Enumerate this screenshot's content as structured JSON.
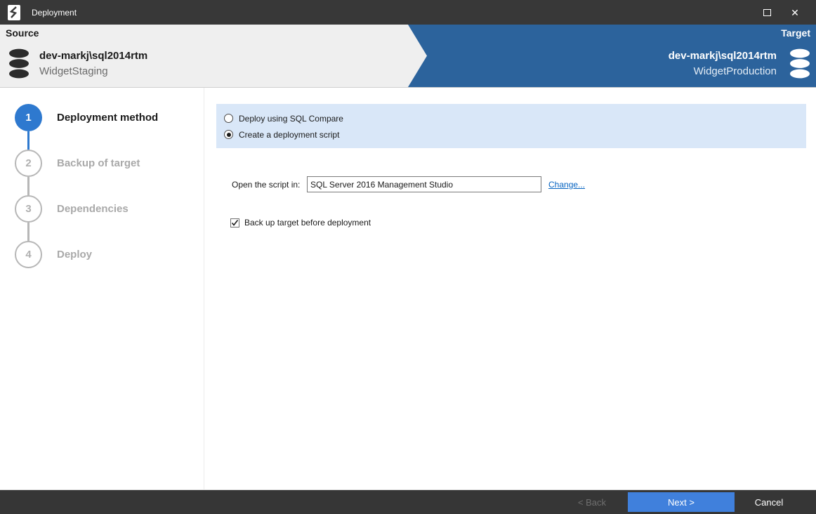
{
  "window": {
    "title": "Deployment"
  },
  "icons": {
    "close": "✕"
  },
  "header": {
    "source": {
      "label": "Source",
      "server": "dev-markj\\sql2014rtm",
      "database": "WidgetStaging"
    },
    "target": {
      "label": "Target",
      "server": "dev-markj\\sql2014rtm",
      "database": "WidgetProduction"
    }
  },
  "steps": [
    {
      "number": "1",
      "label": "Deployment method",
      "state": "active"
    },
    {
      "number": "2",
      "label": "Backup of target",
      "state": "pending"
    },
    {
      "number": "3",
      "label": "Dependencies",
      "state": "pending"
    },
    {
      "number": "4",
      "label": "Deploy",
      "state": "pending"
    }
  ],
  "main": {
    "radio_options": [
      {
        "label": "Deploy using SQL Compare",
        "selected": false
      },
      {
        "label": "Create a deployment script",
        "selected": true
      }
    ],
    "open_script": {
      "label": "Open the script in:",
      "value": "SQL Server 2016 Management Studio",
      "change_link": "Change..."
    },
    "backup_checkbox": {
      "label": "Back up target before deployment",
      "checked": true
    }
  },
  "footer": {
    "back": "< Back",
    "next": "Next >",
    "cancel": "Cancel"
  },
  "colors": {
    "titlebar": "#383838",
    "header_gray": "#efefef",
    "header_blue": "#2c639c",
    "step_active_blue": "#2e79cf",
    "panel_blue": "#d9e7f8",
    "link_blue": "#0563c1",
    "next_button_blue": "#4080dc",
    "footer_dark": "#363636"
  }
}
